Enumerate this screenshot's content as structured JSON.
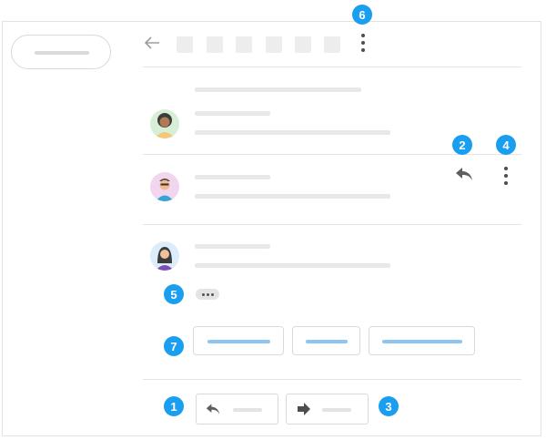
{
  "toolbar": {
    "back_icon": "arrow-left-icon",
    "action_count": 6,
    "more_icon": "more-vert-icon"
  },
  "messages": [
    {
      "sender": "avatar-woman-curly",
      "avatar_bg": "#d6efd6"
    },
    {
      "sender": "avatar-man-glasses",
      "avatar_bg": "#f2d6f0"
    },
    {
      "sender": "avatar-woman-longhair",
      "avatar_bg": "#dcecfa"
    }
  ],
  "message_actions": {
    "reply_icon": "reply-icon",
    "more_icon": "more-vert-icon"
  },
  "smart_replies": {
    "count": 3,
    "accent": "#8dc5f3"
  },
  "bottom_actions": {
    "reply_icon": "reply-icon",
    "forward_icon": "forward-icon"
  },
  "callouts": {
    "color": "#1a9ff0",
    "labels": [
      "1",
      "2",
      "3",
      "4",
      "5",
      "6",
      "7"
    ]
  }
}
